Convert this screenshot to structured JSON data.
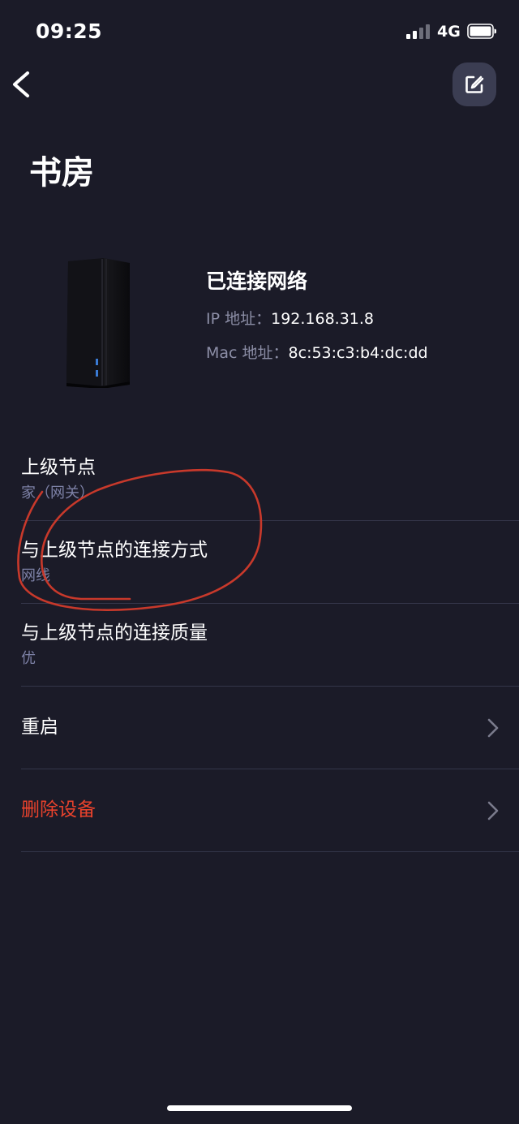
{
  "status_bar": {
    "time": "09:25",
    "network": "4G"
  },
  "header": {
    "back_icon": "chevron-left-icon",
    "edit_icon": "edit-icon"
  },
  "room": {
    "title": "书房"
  },
  "device": {
    "image": "mesh-router-tower-image",
    "connection_status": "已连接网络",
    "ip_label": "IP 地址：",
    "ip_value": "192.168.31.8",
    "mac_label": "Mac 地址：",
    "mac_value": "8c:53:c3:b4:dc:dd"
  },
  "rows": [
    {
      "title": "上级节点",
      "value": "家（网关）"
    },
    {
      "title": "与上级节点的连接方式",
      "value": "网线"
    },
    {
      "title": "与上级节点的连接质量",
      "value": "优"
    },
    {
      "title": "重启",
      "icon": "chevron-right-icon"
    },
    {
      "title": "删除设备",
      "icon": "chevron-right-icon"
    }
  ],
  "colors": {
    "background": "#1b1b28",
    "secondary_text": "#7d81a6",
    "danger": "#e8422c",
    "annotation": "#c8392b",
    "edit_button_bg": "#3b3d52"
  }
}
